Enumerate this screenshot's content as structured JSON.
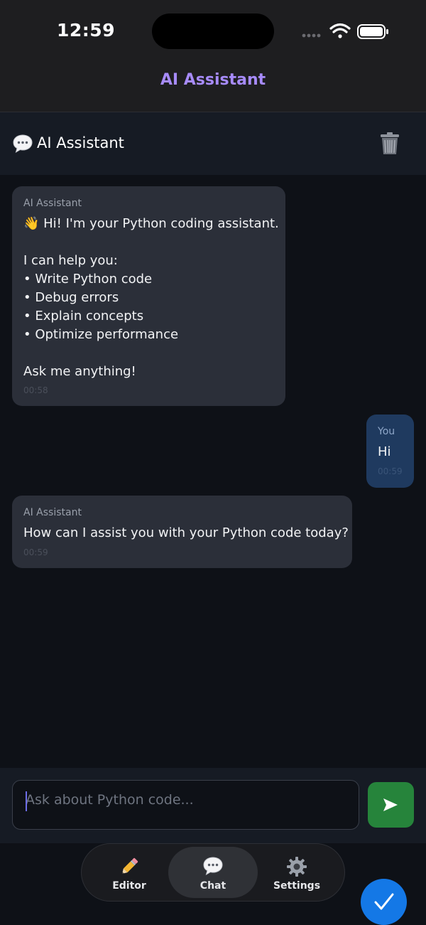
{
  "status_bar": {
    "time": "12:59"
  },
  "nav": {
    "title": "AI Assistant"
  },
  "chat_header": {
    "title": "AI Assistant",
    "icon": "speech-bubble-icon",
    "delete_icon": "trash-icon"
  },
  "messages": [
    {
      "role": "assistant",
      "sender": "AI Assistant",
      "text": "👋 Hi! I'm your Python coding assistant.\n\nI can help you:\n• Write Python code\n• Debug errors\n• Explain concepts\n• Optimize performance\n\nAsk me anything!",
      "time": "00:58"
    },
    {
      "role": "user",
      "sender": "You",
      "text": "Hi",
      "time": "00:59"
    },
    {
      "role": "assistant",
      "sender": "AI Assistant",
      "text": "How can I assist you with your Python code today?",
      "time": "00:59"
    }
  ],
  "input": {
    "placeholder": "Ask about Python code...",
    "value": ""
  },
  "send_button": {
    "icon": "send-arrow-icon",
    "color": "#26843b"
  },
  "tabs": [
    {
      "label": "Editor",
      "icon": "pencil-icon",
      "active": false
    },
    {
      "label": "Chat",
      "icon": "speech-bubble-icon",
      "active": true
    },
    {
      "label": "Settings",
      "icon": "gear-icon",
      "active": false
    }
  ],
  "fab": {
    "icon": "checkmark-icon",
    "color": "#1478e6"
  },
  "colors": {
    "accent": "#a78bfa",
    "background": "#0e1117",
    "ai_bubble": "#2b2f39",
    "user_bubble": "#1f3a5f"
  }
}
